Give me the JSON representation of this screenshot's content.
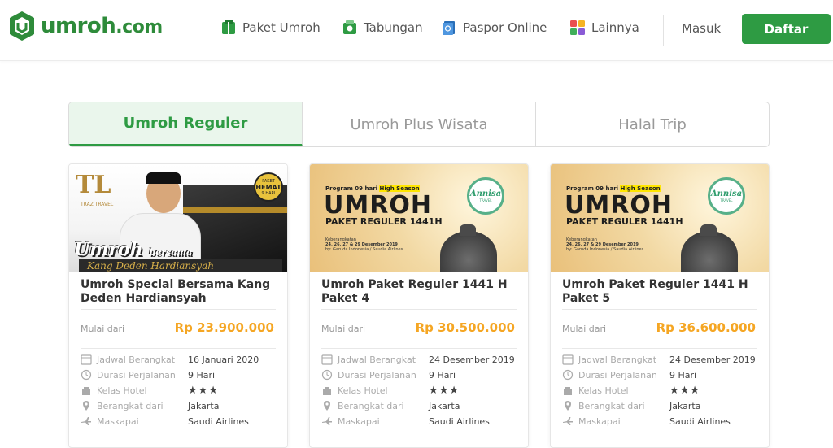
{
  "brand": {
    "name_main": "umroh",
    "name_suffix": ".com"
  },
  "nav": {
    "items": [
      {
        "label": "Paket Umroh",
        "icon": "package-icon"
      },
      {
        "label": "Tabungan",
        "icon": "savings-icon"
      },
      {
        "label": "Paspor Online",
        "icon": "passport-icon"
      },
      {
        "label": "Lainnya",
        "icon": "grid-icon"
      }
    ],
    "login": "Masuk",
    "register": "Daftar"
  },
  "colors": {
    "brand_green": "#2e9b43",
    "price_orange": "#f5a623"
  },
  "tabs": [
    {
      "label": "Umroh Reguler",
      "active": true
    },
    {
      "label": "Umroh Plus Wisata",
      "active": false
    },
    {
      "label": "Halal Trip",
      "active": false
    }
  ],
  "cards": [
    {
      "title": "Umroh Special Bersama Kang Deden Hardiansyah",
      "from_label": "Mulai dari",
      "price": "Rp 23.900.000",
      "rows": [
        {
          "label": "Jadwal Berangkat",
          "value": "16 Januari 2020"
        },
        {
          "label": "Durasi Perjalanan",
          "value": "9 Hari"
        },
        {
          "label": "Kelas Hotel",
          "value": "★★★"
        },
        {
          "label": "Berangkat dari",
          "value": "Jakarta"
        },
        {
          "label": "Maskapai",
          "value": "Saudi Airlines"
        }
      ],
      "hotel_stars": 3,
      "banner": {
        "logo": "TL",
        "logo_sub": "TRAZ TRAVEL",
        "badge_top": "PAKET",
        "badge_main": "HEMAT",
        "badge_bottom": "9 HARI",
        "script": "Umroh",
        "script_small": "bersama",
        "name": "Kang Deden Hardiansyah"
      }
    },
    {
      "title": "Umroh Paket Reguler 1441 H Paket 4",
      "from_label": "Mulai dari",
      "price": "Rp 30.500.000",
      "rows": [
        {
          "label": "Jadwal Berangkat",
          "value": "24 Desember 2019"
        },
        {
          "label": "Durasi Perjalanan",
          "value": "9 Hari"
        },
        {
          "label": "Kelas Hotel",
          "value": "★★★"
        },
        {
          "label": "Berangkat dari",
          "value": "Jakarta"
        },
        {
          "label": "Maskapai",
          "value": "Saudi Airlines"
        }
      ],
      "hotel_stars": 3,
      "banner": {
        "program_prefix": "Program 09 hari",
        "program_highlight": "High Season",
        "headline": "UMROH",
        "subline": "PAKET REGULER 1441H",
        "dep_label": "Keberangkatan",
        "dep_dates": "24, 26, 27 & 29 Desember 2019",
        "dep_by": "by: Garuda Indonesia / Saudia Airlines",
        "agency": "Annisa",
        "agency_sub": "TRAVEL"
      }
    },
    {
      "title": "Umroh Paket Reguler 1441 H Paket 5",
      "from_label": "Mulai dari",
      "price": "Rp 36.600.000",
      "rows": [
        {
          "label": "Jadwal Berangkat",
          "value": "24 Desember 2019"
        },
        {
          "label": "Durasi Perjalanan",
          "value": "9 Hari"
        },
        {
          "label": "Kelas Hotel",
          "value": "★★★"
        },
        {
          "label": "Berangkat dari",
          "value": "Jakarta"
        },
        {
          "label": "Maskapai",
          "value": "Saudi Airlines"
        }
      ],
      "hotel_stars": 3,
      "banner": {
        "program_prefix": "Program 09 hari",
        "program_highlight": "High Season",
        "headline": "UMROH",
        "subline": "PAKET REGULER 1441H",
        "dep_label": "Keberangkatan",
        "dep_dates": "24, 26, 27 & 29 Desember 2019",
        "dep_by": "by: Garuda Indonesia / Saudia Airlines",
        "agency": "Annisa",
        "agency_sub": "TRAVEL"
      }
    }
  ]
}
